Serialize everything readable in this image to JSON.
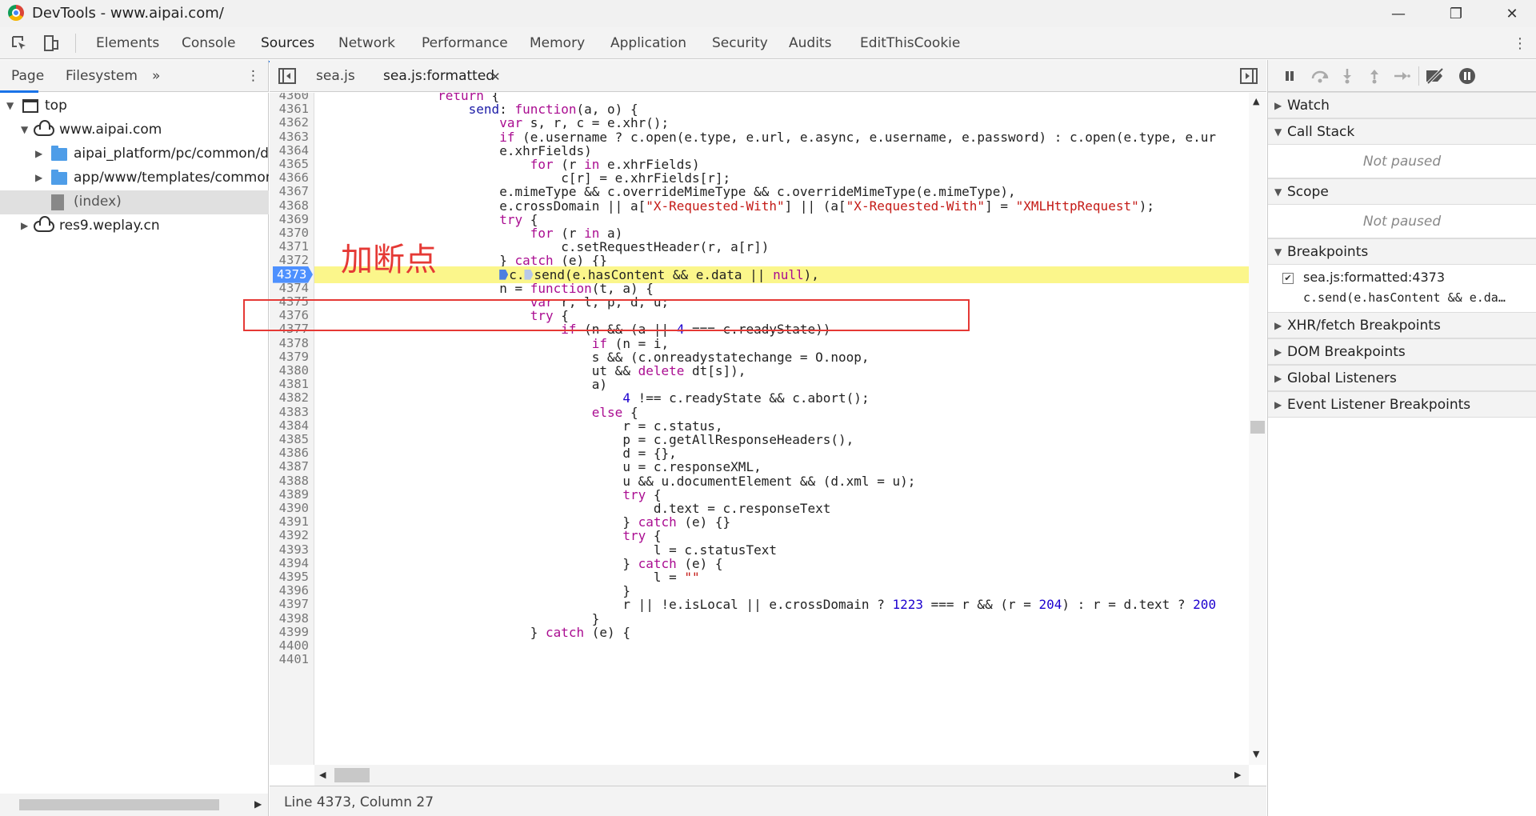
{
  "window": {
    "title": "DevTools - www.aipai.com/",
    "minimize": "—",
    "restore": "❐",
    "close": "✕"
  },
  "main_tabs": [
    "Elements",
    "Console",
    "Sources",
    "Network",
    "Performance",
    "Memory",
    "Application",
    "Security",
    "Audits",
    "EditThisCookie"
  ],
  "active_main_tab": "Sources",
  "navigator": {
    "tabs": [
      "Page",
      "Filesystem"
    ],
    "more": "»",
    "tree": [
      {
        "label": "top",
        "level": 0,
        "icon": "frame"
      },
      {
        "label": "www.aipai.com",
        "level": 1,
        "icon": "cloud"
      },
      {
        "label": "aipai_platform/pc/common/dis",
        "level": 2,
        "icon": "folder"
      },
      {
        "label": "app/www/templates/common/",
        "level": 2,
        "icon": "folder"
      },
      {
        "label": "(index)",
        "level": 2,
        "icon": "file"
      },
      {
        "label": "res9.weplay.cn",
        "level": 0,
        "icon": "cloud"
      }
    ]
  },
  "editor": {
    "tabs": [
      "sea.js",
      "sea.js:formatted"
    ],
    "active_tab": "sea.js:formatted",
    "close_glyph": "✕",
    "breakpoint_line": "4373",
    "lines": [
      {
        "n": "4360",
        "code": "                return {"
      },
      {
        "n": "4361",
        "code": "                    send: function(a, o) {"
      },
      {
        "n": "4362",
        "code": "                        var s, r, c = e.xhr();"
      },
      {
        "n": "4363",
        "code": "                        if (e.username ? c.open(e.type, e.url, e.async, e.username, e.password) : c.open(e.type, e.ur"
      },
      {
        "n": "4364",
        "code": "                        e.xhrFields)"
      },
      {
        "n": "4365",
        "code": "                            for (r in e.xhrFields)"
      },
      {
        "n": "4366",
        "code": "                                c[r] = e.xhrFields[r];"
      },
      {
        "n": "4367",
        "code": "                        e.mimeType && c.overrideMimeType && c.overrideMimeType(e.mimeType),"
      },
      {
        "n": "4368",
        "code": "                        e.crossDomain || a[\"X-Requested-With\"] || (a[\"X-Requested-With\"] = \"XMLHttpRequest\");"
      },
      {
        "n": "4369",
        "code": "                        try {"
      },
      {
        "n": "4370",
        "code": "                            for (r in a)"
      },
      {
        "n": "4371",
        "code": "                                c.setRequestHeader(r, a[r])"
      },
      {
        "n": "4372",
        "code": "                        } catch (e) {}"
      },
      {
        "n": "4373",
        "code": "c.send(e.hasContent && e.data || null),"
      },
      {
        "n": "4374",
        "code": "                        n = function(t, a) {"
      },
      {
        "n": "4375",
        "code": "                            var r, l, p, d, u;"
      },
      {
        "n": "4376",
        "code": "                            try {"
      },
      {
        "n": "4377",
        "code": "                                if (n && (a || 4 === c.readyState))"
      },
      {
        "n": "4378",
        "code": "                                    if (n = i,"
      },
      {
        "n": "4379",
        "code": "                                    s && (c.onreadystatechange = O.noop,"
      },
      {
        "n": "4380",
        "code": "                                    ut && delete dt[s]),"
      },
      {
        "n": "4381",
        "code": "                                    a)"
      },
      {
        "n": "4382",
        "code": "                                        4 !== c.readyState && c.abort();"
      },
      {
        "n": "4383",
        "code": "                                    else {"
      },
      {
        "n": "4384",
        "code": "                                        r = c.status,"
      },
      {
        "n": "4385",
        "code": "                                        p = c.getAllResponseHeaders(),"
      },
      {
        "n": "4386",
        "code": "                                        d = {},"
      },
      {
        "n": "4387",
        "code": "                                        u = c.responseXML,"
      },
      {
        "n": "4388",
        "code": "                                        u && u.documentElement && (d.xml = u);"
      },
      {
        "n": "4389",
        "code": "                                        try {"
      },
      {
        "n": "4390",
        "code": "                                            d.text = c.responseText"
      },
      {
        "n": "4391",
        "code": "                                        } catch (e) {}"
      },
      {
        "n": "4392",
        "code": "                                        try {"
      },
      {
        "n": "4393",
        "code": "                                            l = c.statusText"
      },
      {
        "n": "4394",
        "code": "                                        } catch (e) {"
      },
      {
        "n": "4395",
        "code": "                                            l = \"\""
      },
      {
        "n": "4396",
        "code": "                                        }"
      },
      {
        "n": "4397",
        "code": "                                        r || !e.isLocal || e.crossDomain ? 1223 === r && (r = 204) : r = d.text ? 200"
      },
      {
        "n": "4398",
        "code": "                                    }"
      },
      {
        "n": "4399",
        "code": "                            } catch (e) {"
      },
      {
        "n": "4400",
        "code": ""
      },
      {
        "n": "4401",
        "code": ""
      }
    ]
  },
  "annotation": {
    "text": "加断点",
    "color": "#e53935"
  },
  "status_bar": {
    "position": "Line 4373, Column 27"
  },
  "debugger": {
    "sections": {
      "watch": "Watch",
      "call_stack": "Call Stack",
      "scope": "Scope",
      "breakpoints": "Breakpoints",
      "xhr": "XHR/fetch Breakpoints",
      "dom": "DOM Breakpoints",
      "global": "Global Listeners",
      "event": "Event Listener Breakpoints"
    },
    "not_paused": "Not paused",
    "breakpoint_item": {
      "file": "sea.js:formatted:4373",
      "code": "c.send(e.hasContent && e.da…",
      "checked": true
    }
  },
  "colors": {
    "accent": "#1a73e8",
    "highlight": "#fbf68b",
    "breakpoint": "#4d90fe",
    "keyword": "#aa0d91",
    "string": "#c41a16",
    "number": "#1c00cf"
  }
}
